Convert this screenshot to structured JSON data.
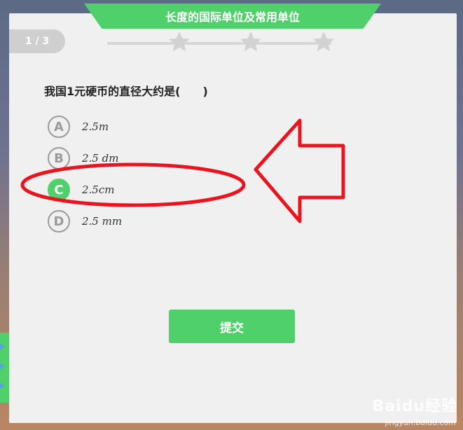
{
  "header": {
    "title": "长度的国际单位及常用单位"
  },
  "progress": {
    "label": "1 / 3",
    "current": 1,
    "total": 3,
    "stars_total": 3,
    "stars_earned": 0
  },
  "question": {
    "text": "我国1元硬币的直径大约是(　　)",
    "selected": "C",
    "options": [
      {
        "letter": "A",
        "text": "2.5m"
      },
      {
        "letter": "B",
        "text": "2.5 dm"
      },
      {
        "letter": "C",
        "text": "2.5cm"
      },
      {
        "letter": "D",
        "text": "2.5 mm"
      }
    ]
  },
  "actions": {
    "submit_label": "提交"
  },
  "watermark": {
    "brand": "Baidu经验",
    "url": "jingyan.baidu.com"
  },
  "colors": {
    "accent": "#4fd06a",
    "annotation": "#e8141e",
    "inactive": "#9a9a9a"
  }
}
